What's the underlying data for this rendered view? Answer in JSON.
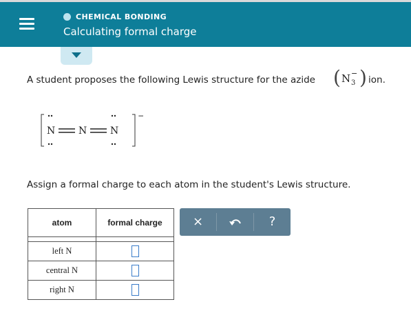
{
  "header": {
    "section": "CHEMICAL BONDING",
    "title": "Calculating formal charge",
    "colors": {
      "bar": "#0e7e99",
      "dot": "#bde4ef"
    }
  },
  "question": {
    "text": "A student proposes the following Lewis structure for the azide",
    "formula": {
      "symbol": "N",
      "subscript": "3",
      "charge": "−"
    },
    "tail": "ion."
  },
  "lewis_structure": {
    "atoms": [
      "N",
      "N",
      "N"
    ],
    "bonds": [
      "double",
      "double"
    ],
    "charge": "−"
  },
  "instruction": "Assign a formal charge to each atom in the student's Lewis structure.",
  "table": {
    "headers": {
      "atom": "atom",
      "formal_charge": "formal charge"
    },
    "rows": [
      {
        "atom": "left N",
        "value": ""
      },
      {
        "atom": "central N",
        "value": ""
      },
      {
        "atom": "right N",
        "value": ""
      }
    ]
  },
  "toolbar": {
    "clear": "×",
    "undo_icon": "undo-icon",
    "help": "?"
  }
}
